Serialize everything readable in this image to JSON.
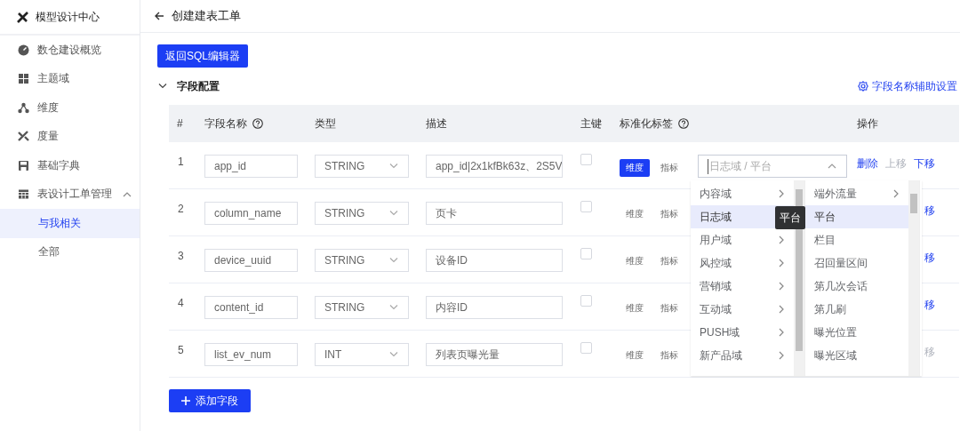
{
  "sidebar": {
    "title": "模型设计中心",
    "items": [
      {
        "label": "数仓建设概览",
        "selected": false
      },
      {
        "label": "主题域",
        "selected": false
      },
      {
        "label": "维度",
        "selected": false
      },
      {
        "label": "度量",
        "selected": false
      },
      {
        "label": "基础字典",
        "selected": false
      },
      {
        "label": "表设计工单管理",
        "selected": false,
        "expanded": true,
        "children": [
          {
            "label": "与我相关",
            "selected": true
          },
          {
            "label": "全部",
            "selected": false
          }
        ]
      }
    ]
  },
  "header": {
    "title": "创建建表工单"
  },
  "toolbar": {
    "button": "返回SQL编辑器"
  },
  "section": {
    "title": "字段配置",
    "expanded": true,
    "link": "字段名称辅助设置"
  },
  "table": {
    "columns": [
      {
        "label": "#"
      },
      {
        "label": "字段名称",
        "help": true
      },
      {
        "label": "类型"
      },
      {
        "label": "描述"
      },
      {
        "label": "主键"
      },
      {
        "label": "标准化标签",
        "help": true
      },
      {
        "label": "操作"
      }
    ],
    "rows": [
      {
        "index": "1",
        "name": "app_id",
        "type": "STRING",
        "description": "app_id|2x1kfBk63z、2S5V",
        "primary_key": false,
        "tags": [
          {
            "label": "维度",
            "selected": true
          },
          {
            "label": "指标",
            "selected": false
          }
        ],
        "tag_path": {
          "placeholder": "日志域 / 平台",
          "expanded": true
        },
        "actions": [
          {
            "label": "删除",
            "disabled": false
          },
          {
            "label": "上移",
            "disabled": true
          },
          {
            "label": "下移",
            "disabled": false
          }
        ]
      },
      {
        "index": "2",
        "name": "column_name",
        "type": "STRING",
        "description": "页卡",
        "primary_key": false,
        "tags": [
          {
            "label": "维度",
            "selected": false
          },
          {
            "label": "指标",
            "selected": false
          }
        ],
        "actions": [
          {
            "label": "移",
            "disabled": false
          }
        ]
      },
      {
        "index": "3",
        "name": "device_uuid",
        "type": "STRING",
        "description": "设备ID",
        "primary_key": false,
        "tags": [
          {
            "label": "维度",
            "selected": false
          },
          {
            "label": "指标",
            "selected": false
          }
        ],
        "actions": [
          {
            "label": "移",
            "disabled": false
          }
        ]
      },
      {
        "index": "4",
        "name": "content_id",
        "type": "STRING",
        "description": "内容ID",
        "primary_key": false,
        "tags": [
          {
            "label": "维度",
            "selected": false
          },
          {
            "label": "指标",
            "selected": false
          }
        ],
        "actions": [
          {
            "label": "移",
            "disabled": false
          }
        ]
      },
      {
        "index": "5",
        "name": "list_ev_num",
        "type": "INT",
        "description": "列表页曝光量",
        "primary_key": false,
        "tags": [
          {
            "label": "维度",
            "selected": false
          },
          {
            "label": "指标",
            "selected": false
          }
        ],
        "actions": [
          {
            "label": "移",
            "disabled": true
          }
        ]
      }
    ]
  },
  "add_button": {
    "label": "添加字段"
  },
  "cascader_menu": {
    "tooltip": "平台",
    "columns": [
      {
        "items": [
          {
            "label": "内容域",
            "selected": false,
            "expandable": true
          },
          {
            "label": "日志域",
            "selected": true,
            "expandable": false
          },
          {
            "label": "用户域",
            "selected": false,
            "expandable": true
          },
          {
            "label": "风控域",
            "selected": false,
            "expandable": true
          },
          {
            "label": "营销域",
            "selected": false,
            "expandable": true
          },
          {
            "label": "互动域",
            "selected": false,
            "expandable": true
          },
          {
            "label": "PUSH域",
            "selected": false,
            "expandable": true
          },
          {
            "label": "新产品域",
            "selected": false,
            "expandable": true
          }
        ]
      },
      {
        "items": [
          {
            "label": "端外流量",
            "selected": false,
            "expandable": true
          },
          {
            "label": "平台",
            "selected": true,
            "expandable": false
          },
          {
            "label": "栏目",
            "selected": false,
            "expandable": false
          },
          {
            "label": "召回量区间",
            "selected": false,
            "expandable": false
          },
          {
            "label": "第几次会话",
            "selected": false,
            "expandable": false
          },
          {
            "label": "第几刷",
            "selected": false,
            "expandable": false
          },
          {
            "label": "曝光位置",
            "selected": false,
            "expandable": false
          },
          {
            "label": "曝光区域",
            "selected": false,
            "expandable": false
          }
        ]
      }
    ]
  }
}
